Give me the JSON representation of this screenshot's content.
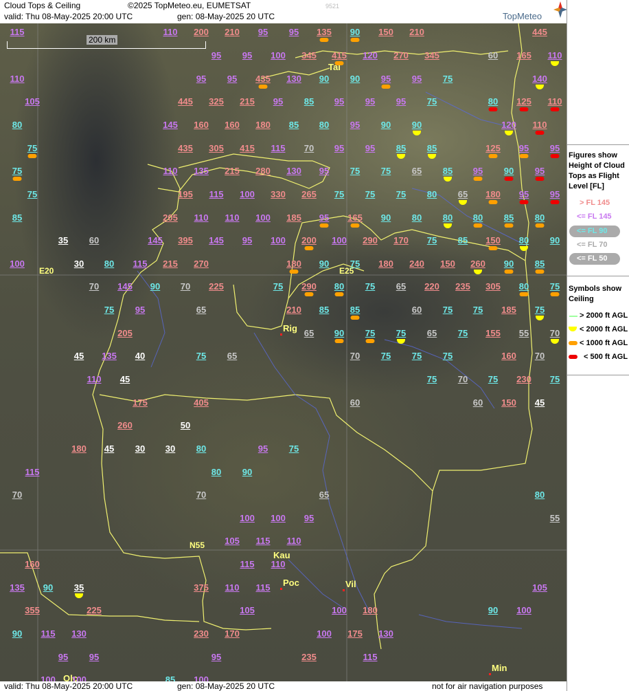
{
  "header": {
    "title": "Cloud Tops & Ceiling",
    "copyright": "©2025 TopMeteo.eu, EUMETSAT",
    "valid": "valid:  Thu  08-May-2025  20:00 UTC",
    "gen": "gen: 08-May-2025 20 UTC",
    "code": "9521",
    "brand": "TopMeteo"
  },
  "scale_label": "200 km",
  "axis_labels": [
    "E20",
    "E25",
    "N55"
  ],
  "cities": [
    "Tal",
    "Rig",
    "Kau",
    "Poc",
    "Vil",
    "Min",
    "Olc"
  ],
  "legend": {
    "figures_title": "Figures show Height of Cloud Tops as Flight Level  [FL]",
    "fl_gt145": "> FL 145",
    "fl_le145": "<= FL 145",
    "fl_le90": "<= FL 90",
    "fl_le70": "<= FL 70",
    "fl_le50": "<= FL 50",
    "symbols_title": "Symbols show Ceiling",
    "ceil_gt2000": "> 2000 ft AGL",
    "ceil_lt2000": "< 2000 ft AGL",
    "ceil_lt1000": "< 1000 ft AGL",
    "ceil_lt500": "< 500 ft AGL"
  },
  "footer": {
    "valid": "valid:  Thu  08-May-2025  20:00 UTC",
    "gen": "gen: 08-May-2025 20 UTC",
    "disclaimer": "not for air navigation purposes"
  },
  "colors": {
    "gt145": "#f08c8c",
    "le145": "#c878f0",
    "le90": "#6ee8e8",
    "le70": "#c8c8c8",
    "le50": "#ffffff",
    "ceil_lt2000": "#ffff00",
    "ceil_lt1000": "#ffa000",
    "ceil_lt500": "#ee0000",
    "ceil_gt2000": "#a0ffa0"
  },
  "values": [
    {
      "v": "115",
      "c": "vio"
    },
    {
      "v": "110",
      "c": "vio"
    },
    {
      "v": "200",
      "c": "red"
    },
    {
      "v": "210",
      "c": "red"
    },
    {
      "v": "95",
      "c": "vio"
    },
    {
      "v": "95",
      "c": "vio"
    },
    {
      "v": "135",
      "c": "red",
      "s": "o"
    },
    {
      "v": "90",
      "c": "cyan",
      "s": "o"
    },
    {
      "v": "150",
      "c": "red"
    },
    {
      "v": "210",
      "c": "red"
    },
    {
      "v": "445",
      "c": "red"
    },
    {
      "v": "95",
      "c": "vio"
    },
    {
      "v": "95",
      "c": "vio"
    },
    {
      "v": "100",
      "c": "vio"
    },
    {
      "v": "345",
      "c": "red"
    },
    {
      "v": "415",
      "c": "red",
      "s": "o"
    },
    {
      "v": "120",
      "c": "vio"
    },
    {
      "v": "270",
      "c": "red"
    },
    {
      "v": "345",
      "c": "red"
    },
    {
      "v": "60",
      "c": "gray"
    },
    {
      "v": "165",
      "c": "red"
    },
    {
      "v": "110",
      "c": "vio",
      "s": "y"
    },
    {
      "v": "110",
      "c": "vio"
    },
    {
      "v": "95",
      "c": "vio"
    },
    {
      "v": "95",
      "c": "vio"
    },
    {
      "v": "435",
      "c": "red",
      "s": "o"
    },
    {
      "v": "130",
      "c": "vio"
    },
    {
      "v": "90",
      "c": "cyan"
    },
    {
      "v": "90",
      "c": "cyan"
    },
    {
      "v": "95",
      "c": "vio",
      "s": "o"
    },
    {
      "v": "95",
      "c": "vio"
    },
    {
      "v": "75",
      "c": "cyan"
    },
    {
      "v": "140",
      "c": "vio",
      "s": "y"
    },
    {
      "v": "105",
      "c": "vio"
    },
    {
      "v": "445",
      "c": "red"
    },
    {
      "v": "325",
      "c": "red"
    },
    {
      "v": "215",
      "c": "red"
    },
    {
      "v": "95",
      "c": "vio"
    },
    {
      "v": "85",
      "c": "cyan"
    },
    {
      "v": "95",
      "c": "vio"
    },
    {
      "v": "95",
      "c": "vio"
    },
    {
      "v": "95",
      "c": "vio"
    },
    {
      "v": "75",
      "c": "cyan"
    },
    {
      "v": "80",
      "c": "cyan",
      "s": "r"
    },
    {
      "v": "125",
      "c": "red",
      "s": "r"
    },
    {
      "v": "110",
      "c": "red",
      "s": "r"
    },
    {
      "v": "80",
      "c": "cyan"
    },
    {
      "v": "145",
      "c": "vio"
    },
    {
      "v": "160",
      "c": "red"
    },
    {
      "v": "160",
      "c": "red"
    },
    {
      "v": "180",
      "c": "red"
    },
    {
      "v": "85",
      "c": "cyan"
    },
    {
      "v": "80",
      "c": "cyan"
    },
    {
      "v": "95",
      "c": "vio"
    },
    {
      "v": "90",
      "c": "cyan"
    },
    {
      "v": "90",
      "c": "cyan",
      "s": "y"
    },
    {
      "v": "120",
      "c": "vio",
      "s": "y"
    },
    {
      "v": "110",
      "c": "red",
      "s": "r"
    },
    {
      "v": "75",
      "c": "cyan",
      "s": "o"
    },
    {
      "v": "435",
      "c": "red"
    },
    {
      "v": "305",
      "c": "red"
    },
    {
      "v": "415",
      "c": "red"
    },
    {
      "v": "115",
      "c": "vio"
    },
    {
      "v": "70",
      "c": "gray"
    },
    {
      "v": "95",
      "c": "vio"
    },
    {
      "v": "95",
      "c": "vio"
    },
    {
      "v": "85",
      "c": "cyan",
      "s": "y"
    },
    {
      "v": "85",
      "c": "cyan",
      "s": "y"
    },
    {
      "v": "125",
      "c": "red",
      "s": "o"
    },
    {
      "v": "95",
      "c": "vio",
      "s": "o"
    },
    {
      "v": "95",
      "c": "vio",
      "s": "r"
    },
    {
      "v": "75",
      "c": "cyan",
      "s": "o"
    },
    {
      "v": "110",
      "c": "vio"
    },
    {
      "v": "135",
      "c": "vio"
    },
    {
      "v": "215",
      "c": "red"
    },
    {
      "v": "280",
      "c": "red"
    },
    {
      "v": "130",
      "c": "vio"
    },
    {
      "v": "95",
      "c": "vio"
    },
    {
      "v": "75",
      "c": "cyan"
    },
    {
      "v": "75",
      "c": "cyan"
    },
    {
      "v": "65",
      "c": "gray"
    },
    {
      "v": "85",
      "c": "cyan",
      "s": "y"
    },
    {
      "v": "95",
      "c": "vio",
      "s": "o"
    },
    {
      "v": "90",
      "c": "cyan",
      "s": "r"
    },
    {
      "v": "95",
      "c": "vio",
      "s": "r"
    },
    {
      "v": "75",
      "c": "cyan"
    },
    {
      "v": "195",
      "c": "red"
    },
    {
      "v": "115",
      "c": "vio"
    },
    {
      "v": "100",
      "c": "vio"
    },
    {
      "v": "330",
      "c": "red"
    },
    {
      "v": "265",
      "c": "red"
    },
    {
      "v": "75",
      "c": "cyan"
    },
    {
      "v": "75",
      "c": "cyan"
    },
    {
      "v": "75",
      "c": "cyan"
    },
    {
      "v": "80",
      "c": "cyan"
    },
    {
      "v": "65",
      "c": "gray",
      "s": "y"
    },
    {
      "v": "180",
      "c": "red",
      "s": "o"
    },
    {
      "v": "95",
      "c": "vio",
      "s": "r"
    },
    {
      "v": "95",
      "c": "vio",
      "s": "r"
    },
    {
      "v": "85",
      "c": "cyan"
    },
    {
      "v": "205",
      "c": "red"
    },
    {
      "v": "110",
      "c": "vio"
    },
    {
      "v": "110",
      "c": "vio"
    },
    {
      "v": "100",
      "c": "vio"
    },
    {
      "v": "185",
      "c": "red"
    },
    {
      "v": "95",
      "c": "vio",
      "s": "o"
    },
    {
      "v": "165",
      "c": "red",
      "s": "o"
    },
    {
      "v": "90",
      "c": "cyan"
    },
    {
      "v": "80",
      "c": "cyan"
    },
    {
      "v": "80",
      "c": "cyan",
      "s": "y"
    },
    {
      "v": "80",
      "c": "cyan",
      "s": "o"
    },
    {
      "v": "85",
      "c": "cyan",
      "s": "o"
    },
    {
      "v": "80",
      "c": "cyan",
      "s": "o"
    },
    {
      "v": "35",
      "c": "white"
    },
    {
      "v": "60",
      "c": "gray"
    },
    {
      "v": "145",
      "c": "vio"
    },
    {
      "v": "395",
      "c": "red"
    },
    {
      "v": "145",
      "c": "vio"
    },
    {
      "v": "95",
      "c": "vio"
    },
    {
      "v": "100",
      "c": "vio"
    },
    {
      "v": "200",
      "c": "red",
      "s": "o"
    },
    {
      "v": "100",
      "c": "vio"
    },
    {
      "v": "290",
      "c": "red"
    },
    {
      "v": "170",
      "c": "red"
    },
    {
      "v": "75",
      "c": "cyan"
    },
    {
      "v": "85",
      "c": "cyan"
    },
    {
      "v": "150",
      "c": "red",
      "s": "o"
    },
    {
      "v": "80",
      "c": "cyan",
      "s": "y"
    },
    {
      "v": "90",
      "c": "cyan"
    },
    {
      "v": "100",
      "c": "vio"
    },
    {
      "v": "30",
      "c": "white"
    },
    {
      "v": "80",
      "c": "cyan"
    },
    {
      "v": "115",
      "c": "vio"
    },
    {
      "v": "215",
      "c": "red"
    },
    {
      "v": "270",
      "c": "red"
    },
    {
      "v": "180",
      "c": "red",
      "s": "o"
    },
    {
      "v": "90",
      "c": "cyan"
    },
    {
      "v": "75",
      "c": "cyan"
    },
    {
      "v": "180",
      "c": "red"
    },
    {
      "v": "240",
      "c": "red"
    },
    {
      "v": "150",
      "c": "red"
    },
    {
      "v": "260",
      "c": "red",
      "s": "y"
    },
    {
      "v": "90",
      "c": "cyan",
      "s": "o"
    },
    {
      "v": "85",
      "c": "cyan",
      "s": "o"
    },
    {
      "v": "70",
      "c": "gray"
    },
    {
      "v": "145",
      "c": "vio"
    },
    {
      "v": "90",
      "c": "cyan"
    },
    {
      "v": "70",
      "c": "gray"
    },
    {
      "v": "225",
      "c": "red"
    },
    {
      "v": "75",
      "c": "cyan"
    },
    {
      "v": "290",
      "c": "red",
      "s": "o"
    },
    {
      "v": "80",
      "c": "cyan",
      "s": "o"
    },
    {
      "v": "75",
      "c": "cyan"
    },
    {
      "v": "65",
      "c": "gray"
    },
    {
      "v": "220",
      "c": "red"
    },
    {
      "v": "235",
      "c": "red"
    },
    {
      "v": "305",
      "c": "red"
    },
    {
      "v": "80",
      "c": "cyan",
      "s": "o"
    },
    {
      "v": "75",
      "c": "cyan",
      "s": "o"
    },
    {
      "v": "75",
      "c": "cyan"
    },
    {
      "v": "95",
      "c": "vio"
    },
    {
      "v": "65",
      "c": "gray"
    },
    {
      "v": "210",
      "c": "red"
    },
    {
      "v": "85",
      "c": "cyan"
    },
    {
      "v": "85",
      "c": "cyan",
      "s": "o"
    },
    {
      "v": "60",
      "c": "gray"
    },
    {
      "v": "75",
      "c": "cyan"
    },
    {
      "v": "75",
      "c": "cyan"
    },
    {
      "v": "185",
      "c": "red"
    },
    {
      "v": "75",
      "c": "cyan",
      "s": "y"
    },
    {
      "v": "205",
      "c": "red"
    },
    {
      "v": "65",
      "c": "gray"
    },
    {
      "v": "90",
      "c": "cyan",
      "s": "o"
    },
    {
      "v": "75",
      "c": "cyan",
      "s": "o"
    },
    {
      "v": "75",
      "c": "cyan",
      "s": "y"
    },
    {
      "v": "65",
      "c": "gray"
    },
    {
      "v": "75",
      "c": "cyan"
    },
    {
      "v": "155",
      "c": "red"
    },
    {
      "v": "55",
      "c": "gray"
    },
    {
      "v": "70",
      "c": "gray",
      "s": "y"
    },
    {
      "v": "45",
      "c": "white"
    },
    {
      "v": "135",
      "c": "vio"
    },
    {
      "v": "40",
      "c": "white"
    },
    {
      "v": "75",
      "c": "cyan"
    },
    {
      "v": "65",
      "c": "gray"
    },
    {
      "v": "70",
      "c": "gray"
    },
    {
      "v": "75",
      "c": "cyan"
    },
    {
      "v": "75",
      "c": "cyan"
    },
    {
      "v": "75",
      "c": "cyan"
    },
    {
      "v": "160",
      "c": "red"
    },
    {
      "v": "70",
      "c": "gray"
    },
    {
      "v": "110",
      "c": "vio"
    },
    {
      "v": "45",
      "c": "white"
    },
    {
      "v": "75",
      "c": "cyan"
    },
    {
      "v": "70",
      "c": "gray"
    },
    {
      "v": "75",
      "c": "cyan"
    },
    {
      "v": "230",
      "c": "red"
    },
    {
      "v": "75",
      "c": "cyan"
    },
    {
      "v": "175",
      "c": "red"
    },
    {
      "v": "405",
      "c": "red"
    },
    {
      "v": "60",
      "c": "gray"
    },
    {
      "v": "60",
      "c": "gray"
    },
    {
      "v": "150",
      "c": "red"
    },
    {
      "v": "45",
      "c": "white"
    },
    {
      "v": "260",
      "c": "red"
    },
    {
      "v": "50",
      "c": "white"
    },
    {
      "v": "180",
      "c": "red"
    },
    {
      "v": "45",
      "c": "white"
    },
    {
      "v": "30",
      "c": "white"
    },
    {
      "v": "30",
      "c": "white"
    },
    {
      "v": "80",
      "c": "cyan"
    },
    {
      "v": "95",
      "c": "vio"
    },
    {
      "v": "75",
      "c": "cyan"
    },
    {
      "v": "115",
      "c": "vio"
    },
    {
      "v": "80",
      "c": "cyan"
    },
    {
      "v": "90",
      "c": "cyan"
    },
    {
      "v": "70",
      "c": "gray"
    },
    {
      "v": "70",
      "c": "gray"
    },
    {
      "v": "65",
      "c": "gray"
    },
    {
      "v": "80",
      "c": "cyan"
    },
    {
      "v": "100",
      "c": "vio"
    },
    {
      "v": "100",
      "c": "vio"
    },
    {
      "v": "95",
      "c": "vio"
    },
    {
      "v": "55",
      "c": "gray"
    },
    {
      "v": "105",
      "c": "vio"
    },
    {
      "v": "115",
      "c": "vio"
    },
    {
      "v": "110",
      "c": "vio"
    },
    {
      "v": "160",
      "c": "red"
    },
    {
      "v": "115",
      "c": "vio"
    },
    {
      "v": "110",
      "c": "vio"
    },
    {
      "v": "135",
      "c": "vio"
    },
    {
      "v": "90",
      "c": "cyan"
    },
    {
      "v": "35",
      "c": "white",
      "s": "y"
    },
    {
      "v": "375",
      "c": "red"
    },
    {
      "v": "110",
      "c": "vio"
    },
    {
      "v": "115",
      "c": "vio"
    },
    {
      "v": "105",
      "c": "vio"
    },
    {
      "v": "355",
      "c": "red"
    },
    {
      "v": "225",
      "c": "red"
    },
    {
      "v": "105",
      "c": "vio"
    },
    {
      "v": "100",
      "c": "vio"
    },
    {
      "v": "180",
      "c": "red"
    },
    {
      "v": "90",
      "c": "cyan"
    },
    {
      "v": "100",
      "c": "vio"
    },
    {
      "v": "90",
      "c": "cyan"
    },
    {
      "v": "115",
      "c": "vio"
    },
    {
      "v": "130",
      "c": "vio"
    },
    {
      "v": "230",
      "c": "red"
    },
    {
      "v": "170",
      "c": "red"
    },
    {
      "v": "100",
      "c": "vio"
    },
    {
      "v": "175",
      "c": "red"
    },
    {
      "v": "130",
      "c": "vio"
    },
    {
      "v": "95",
      "c": "vio"
    },
    {
      "v": "95",
      "c": "vio"
    },
    {
      "v": "95",
      "c": "vio"
    },
    {
      "v": "235",
      "c": "red"
    },
    {
      "v": "115",
      "c": "vio"
    },
    {
      "v": "100",
      "c": "vio"
    },
    {
      "v": "100",
      "c": "vio"
    },
    {
      "v": "85",
      "c": "cyan"
    },
    {
      "v": "100",
      "c": "vio"
    }
  ]
}
